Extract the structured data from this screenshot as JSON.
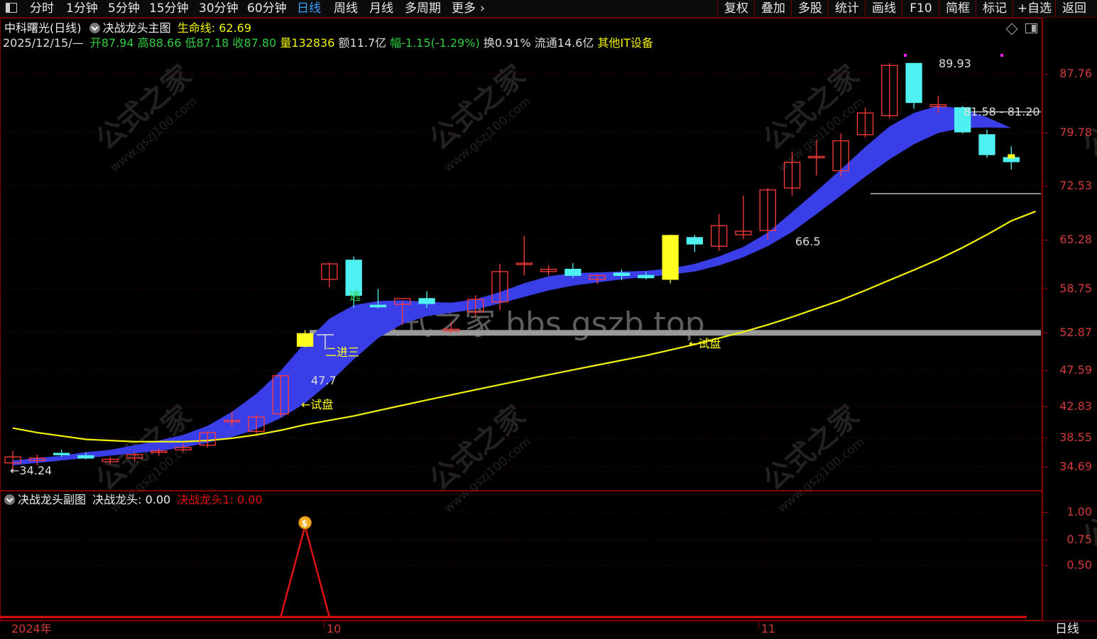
{
  "toolbar": {
    "periods": [
      "分时",
      "1分钟",
      "5分钟",
      "15分钟",
      "30分钟",
      "60分钟",
      "日线",
      "周线",
      "月线",
      "多周期",
      "更多"
    ],
    "active_period": "日线",
    "right_buttons": [
      "复权",
      "叠加",
      "多股",
      "统计",
      "画线",
      "F10",
      "简框",
      "标记",
      "+自选",
      "返回"
    ]
  },
  "main_header": {
    "stock": "中科曙光(日线)",
    "indicator": "决战龙头主图",
    "life_line_label": "生命线:",
    "life_line_value": "62.69",
    "date": "2025/12/15/—",
    "open": "开87.94",
    "high": "高88.66",
    "low": "低87.18",
    "close": "收87.80",
    "volume": "量132836",
    "amount": "额11.7亿",
    "change": "幅-1.15(-1.29%)",
    "turnover": "换0.91%",
    "float_cap": "流通14.6亿",
    "sector": "其他IT设备"
  },
  "sub_header": {
    "indicator": "决战龙头副图",
    "line1": "决战龙头: 0.00",
    "line2": "决战龙头1: 0.00"
  },
  "annotations": {
    "low_label": "←34.24",
    "high_label": "89.93",
    "range_label": "81.58 - 81.20",
    "support_label": "66.5",
    "level_label": "47.7",
    "trial1": "←试盘",
    "trial2": "←试盘",
    "second_third": "二进三",
    "escape": "逃"
  },
  "y_axis_main": [
    "87.76",
    "79.78",
    "72.53",
    "65.28",
    "58.75",
    "52.87",
    "47.59",
    "42.83",
    "38.55",
    "34.69"
  ],
  "y_axis_sub": [
    "1.00",
    "0.75",
    "0.50"
  ],
  "x_axis": [
    "2024年",
    "10",
    "11"
  ],
  "bottom_right": "日线",
  "watermark": {
    "text": "公式之家",
    "url": "www.gszj100.com",
    "center": "公式之家 bbs.gszb.top"
  },
  "colors": {
    "up": "#ff3b3b",
    "down": "#4ff0f0",
    "band": "#3a3ee6",
    "ma": "#f2f20a",
    "signal": "#e01010"
  },
  "chart_data": {
    "type": "candlestick",
    "y_scale": "log",
    "ylim": [
      32.0,
      92.0
    ],
    "candles": [
      {
        "o": 35.0,
        "h": 36.0,
        "l": 34.24,
        "c": 35.5
      },
      {
        "o": 35.2,
        "h": 35.7,
        "l": 34.8,
        "c": 35.4
      },
      {
        "o": 35.8,
        "h": 36.1,
        "l": 35.5,
        "c": 35.7
      },
      {
        "o": 35.6,
        "h": 35.9,
        "l": 35.3,
        "c": 35.4
      },
      {
        "o": 35.1,
        "h": 35.5,
        "l": 34.9,
        "c": 35.3
      },
      {
        "o": 35.4,
        "h": 35.9,
        "l": 35.1,
        "c": 35.7
      },
      {
        "o": 35.9,
        "h": 36.2,
        "l": 35.6,
        "c": 36.0
      },
      {
        "o": 36.1,
        "h": 36.6,
        "l": 35.9,
        "c": 36.3
      },
      {
        "o": 36.5,
        "h": 37.7,
        "l": 36.3,
        "c": 37.6
      },
      {
        "o": 38.6,
        "h": 39.5,
        "l": 38.2,
        "c": 38.7
      },
      {
        "o": 37.7,
        "h": 39.2,
        "l": 37.5,
        "c": 39.0
      },
      {
        "o": 39.3,
        "h": 43.0,
        "l": 39.0,
        "c": 43.0
      },
      {
        "o": 47.5,
        "h": 47.9,
        "l": 46.0,
        "c": 46.1
      },
      {
        "o": 54.0,
        "h": 56.2,
        "l": 53.0,
        "c": 56.0
      },
      {
        "o": 56.5,
        "h": 57.0,
        "l": 50.5,
        "c": 52.0
      },
      {
        "o": 50.8,
        "h": 52.8,
        "l": 50.4,
        "c": 50.6
      },
      {
        "o": 50.9,
        "h": 51.3,
        "l": 48.5,
        "c": 51.6
      },
      {
        "o": 51.6,
        "h": 52.5,
        "l": 50.5,
        "c": 51.0
      },
      {
        "o": 47.8,
        "h": 48.8,
        "l": 47.6,
        "c": 48.0
      },
      {
        "o": 50.0,
        "h": 52.0,
        "l": 49.5,
        "c": 51.5
      },
      {
        "o": 51.2,
        "h": 56.0,
        "l": 50.2,
        "c": 55.0
      },
      {
        "o": 56.0,
        "h": 59.8,
        "l": 54.5,
        "c": 56.1
      },
      {
        "o": 55.0,
        "h": 55.8,
        "l": 54.5,
        "c": 55.3
      },
      {
        "o": 55.3,
        "h": 56.1,
        "l": 54.2,
        "c": 54.5
      },
      {
        "o": 54.0,
        "h": 54.6,
        "l": 53.4,
        "c": 54.5
      },
      {
        "o": 54.8,
        "h": 55.3,
        "l": 53.9,
        "c": 54.5
      },
      {
        "o": 54.5,
        "h": 55.0,
        "l": 54.0,
        "c": 54.2
      },
      {
        "o": 54.0,
        "h": 60.0,
        "l": 53.5,
        "c": 59.9
      },
      {
        "o": 59.6,
        "h": 60.0,
        "l": 57.6,
        "c": 58.7
      },
      {
        "o": 58.4,
        "h": 63.0,
        "l": 57.8,
        "c": 61.3
      },
      {
        "o": 60.0,
        "h": 65.8,
        "l": 59.4,
        "c": 60.5
      },
      {
        "o": 60.6,
        "h": 67.0,
        "l": 59.3,
        "c": 66.7
      },
      {
        "o": 67.0,
        "h": 73.0,
        "l": 65.8,
        "c": 71.2
      },
      {
        "o": 72.0,
        "h": 75.0,
        "l": 69.0,
        "c": 72.2
      },
      {
        "o": 69.8,
        "h": 76.2,
        "l": 68.8,
        "c": 74.9
      },
      {
        "o": 76.0,
        "h": 81.0,
        "l": 75.5,
        "c": 80.0
      },
      {
        "o": 79.5,
        "h": 90.0,
        "l": 79.0,
        "c": 89.5
      },
      {
        "o": 89.93,
        "h": 89.93,
        "l": 80.8,
        "c": 82.0
      },
      {
        "o": 81.2,
        "h": 83.3,
        "l": 80.0,
        "c": 81.58
      },
      {
        "o": 81.0,
        "h": 81.3,
        "l": 76.2,
        "c": 76.5
      },
      {
        "o": 76.0,
        "h": 76.9,
        "l": 72.0,
        "c": 72.5
      },
      {
        "o": 72.0,
        "h": 73.9,
        "l": 70.0,
        "c": 71.3
      }
    ],
    "band_upper": [
      35.2,
      35.4,
      35.6,
      35.9,
      36.1,
      36.5,
      36.9,
      37.4,
      38.2,
      39.5,
      41.2,
      43.5,
      46.5,
      49.2,
      50.8,
      51.3,
      51.4,
      51.2,
      51.1,
      51.5,
      52.4,
      53.5,
      54.4,
      54.8,
      54.9,
      55.0,
      55.1,
      55.4,
      56.0,
      57.0,
      58.3,
      60.3,
      63.3,
      66.5,
      70.0,
      73.8,
      77.5,
      80.0,
      81.4,
      80.8,
      79.2,
      77.2
    ],
    "band_lower": [
      34.8,
      35.0,
      35.2,
      35.4,
      35.6,
      35.8,
      36.0,
      36.3,
      36.7,
      37.2,
      37.9,
      38.9,
      40.3,
      42.3,
      44.7,
      47.0,
      48.6,
      49.5,
      49.9,
      50.3,
      51.0,
      51.8,
      52.6,
      53.2,
      53.6,
      54.0,
      54.3,
      54.6,
      55.0,
      55.8,
      56.9,
      58.4,
      60.4,
      63.0,
      65.8,
      68.8,
      71.7,
      74.3,
      76.3,
      77.2,
      77.3,
      77.2
    ],
    "ma": [
      38.0,
      37.6,
      37.3,
      37.0,
      36.9,
      36.8,
      36.8,
      36.8,
      36.9,
      37.1,
      37.4,
      37.8,
      38.3,
      38.7,
      39.1,
      39.6,
      40.1,
      40.6,
      41.1,
      41.6,
      42.1,
      42.6,
      43.1,
      43.6,
      44.1,
      44.6,
      45.1,
      45.7,
      46.3,
      47.0,
      47.7,
      48.5,
      49.4,
      50.4,
      51.4,
      52.6,
      53.9,
      55.2,
      56.6,
      58.2,
      60.0,
      62.0,
      63.4
    ],
    "support_lines": [
      47.59,
      66.7,
      81.58
    ],
    "signal": [
      0,
      0,
      0,
      0,
      0,
      0,
      0,
      0,
      0,
      0,
      0,
      0,
      1,
      0,
      0,
      0,
      0,
      0,
      0,
      0,
      0,
      0,
      0,
      0,
      0,
      0,
      0,
      0,
      0,
      0,
      0,
      0,
      0,
      0,
      0,
      0,
      0,
      0,
      0,
      0,
      0,
      0
    ]
  }
}
